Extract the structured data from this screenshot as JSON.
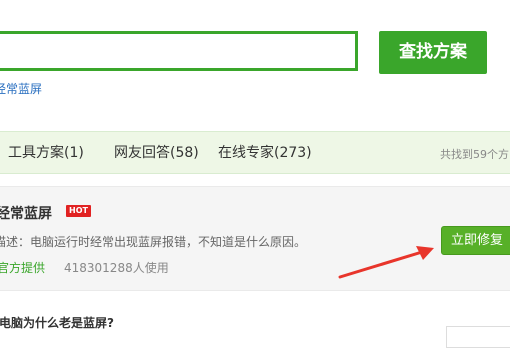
{
  "search": {
    "input_value": "",
    "button_label": "查找方案",
    "suggestion": "经常蓝屏"
  },
  "tabs": [
    {
      "label": "工具方案(1)"
    },
    {
      "label": "网友回答(58)"
    },
    {
      "label": "在线专家(273)"
    }
  ],
  "found_text": "共找到59个方",
  "result": {
    "title": "经常蓝屏",
    "badge": "HOT",
    "description": "描述：电脑运行时经常出现蓝屏报错，不知道是什么原因。",
    "provider": "官方提供",
    "users": "418301288人使用",
    "fix_label": "立即修复"
  },
  "question": {
    "title": "电脑为什么老是蓝屏?"
  },
  "colors": {
    "accent_green": "#3aa62b",
    "hot_red": "#e12222",
    "arrow_red": "#e8352b",
    "link_blue": "#2a6fc0"
  }
}
